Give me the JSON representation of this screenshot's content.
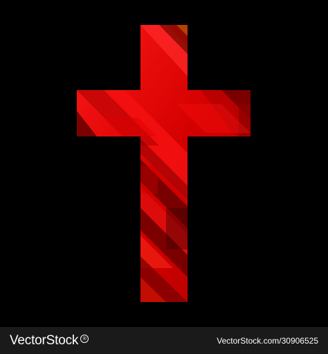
{
  "colors": {
    "background": "#000000",
    "cross_primary": "#e00000",
    "cross_dark": "#8c0000",
    "footer_bg": "#1a1a1a",
    "footer_text": "#ffffff"
  },
  "artwork": {
    "subject_icon": "cross-icon"
  },
  "footer": {
    "brand": "VectorStock",
    "registered_mark": "®",
    "credit": "VectorStock.com/30906525"
  }
}
